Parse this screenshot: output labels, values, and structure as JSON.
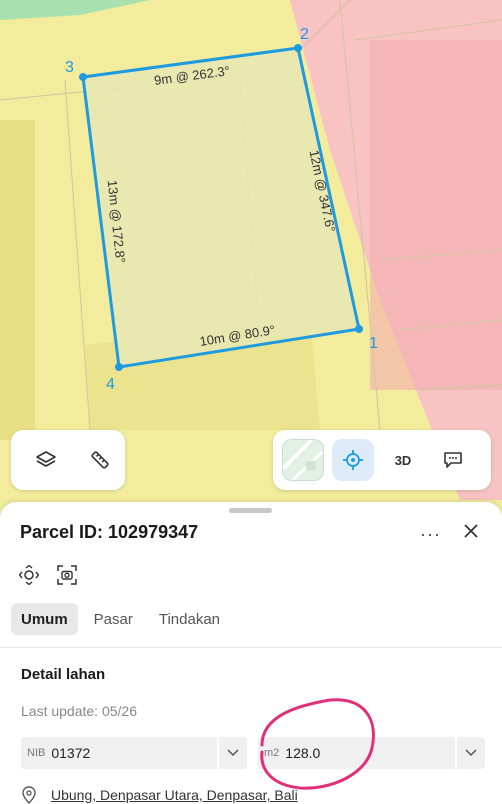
{
  "map": {
    "vertices": [
      {
        "label": "1"
      },
      {
        "label": "2"
      },
      {
        "label": "3"
      },
      {
        "label": "4"
      }
    ],
    "edges": [
      {
        "label": "9m @ 262.3°"
      },
      {
        "label": "12m @ 347.6°"
      },
      {
        "label": "10m @ 80.9°"
      },
      {
        "label": "13m @ 172.8°"
      }
    ],
    "colors": {
      "parcel_stroke": "#1e9be0",
      "parcel_fill": "#e6e8b4",
      "zone_yellow": "#f2ec9c",
      "zone_pink": "#f8c3c2",
      "zone_green": "#a8e0b0",
      "annotation": "#e0307a"
    }
  },
  "toolbar": {
    "layers_icon": "layers-icon",
    "measure_icon": "measure-icon",
    "locate_icon": "crosshair-icon",
    "view_3d_label": "3D",
    "feedback_icon": "feedback-icon"
  },
  "sheet": {
    "title": "Parcel ID: 102979347",
    "more_label": "···",
    "tabs": [
      {
        "label": "Umum",
        "active": true
      },
      {
        "label": "Pasar",
        "active": false
      },
      {
        "label": "Tindakan",
        "active": false
      }
    ],
    "section_title": "Detail lahan",
    "last_update": "Last update: 05/26",
    "nib": {
      "label": "NIB",
      "value": "01372"
    },
    "area": {
      "label": "m2",
      "value": "128.0"
    },
    "address": "Ubung, Denpasar Utara, Denpasar, Bali"
  }
}
